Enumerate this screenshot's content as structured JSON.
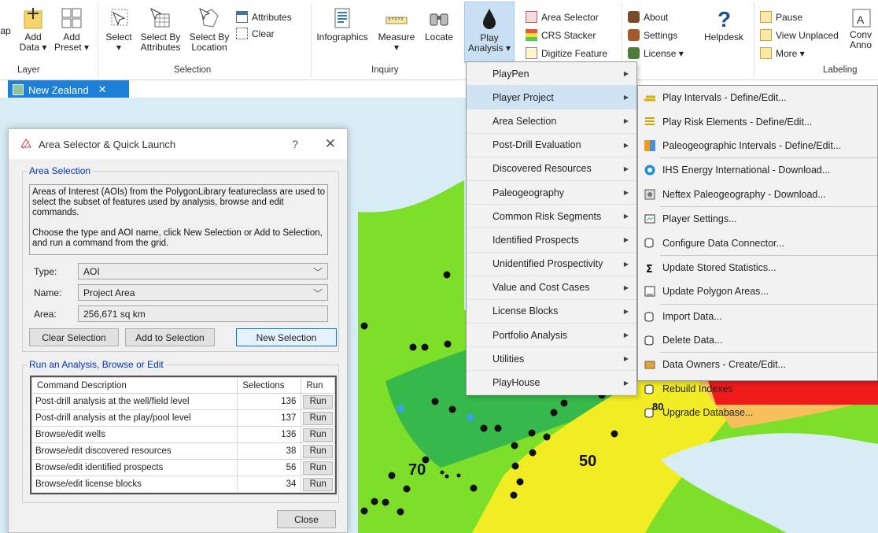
{
  "ribbon": {
    "map_partial": "ap",
    "add_data": "Add\nData ▾",
    "add_preset": "Add\nPreset ▾",
    "select": "Select\n▾",
    "select_by_attributes": "Select By\nAttributes",
    "select_by_location": "Select By\nLocation",
    "attributes": "Attributes",
    "clear": "Clear",
    "infographics": "Infographics",
    "measure": "Measure\n▾",
    "locate": "Locate",
    "play_analysis": "Play\nAnalysis ▾",
    "area_selector": "Area Selector",
    "crs_stacker": "CRS Stacker",
    "digitize_feature": "Digitize Feature",
    "about": "About",
    "settings": "Settings",
    "license": "License ▾",
    "helpdesk": "Helpdesk",
    "pause": "Pause",
    "view_unplaced": "View Unplaced",
    "more": "More ▾",
    "convert_annotation": "Conv\nAnno",
    "groups": {
      "layer": "Layer",
      "selection": "Selection",
      "inquiry": "Inquiry",
      "labeling": "Labeling"
    }
  },
  "doc_tab": {
    "label": "New Zealand",
    "close": "✕"
  },
  "map": {
    "labels": [
      "80",
      "50",
      "70"
    ]
  },
  "dialog": {
    "title": "Area Selector & Quick Launch",
    "help": "?",
    "close": "✕",
    "area_selection": {
      "legend": "Area Selection",
      "description": "Areas of Interest (AOIs) from the PolygonLibrary featureclass are used to select the subset of features used by analysis, browse and edit commands.\n\nChoose the type and AOI name, click New Selection or Add to Selection, and run a command from the grid.",
      "type_label": "Type:",
      "type_value": "AOI",
      "name_label": "Name:",
      "name_value": "Project Area",
      "area_label": "Area:",
      "area_value": "256,671 sq km",
      "clear_selection": "Clear Selection",
      "add_to_selection": "Add to Selection",
      "new_selection": "New Selection"
    },
    "run_group": {
      "legend": "Run an Analysis, Browse or Edit",
      "columns": [
        "Command Description",
        "Selections",
        "Run"
      ],
      "rows": [
        {
          "description": "Post-drill analysis at the well/field level",
          "selections": "136",
          "run": "Run"
        },
        {
          "description": "Post-drill analysis at the play/pool level",
          "selections": "137",
          "run": "Run"
        },
        {
          "description": "Browse/edit wells",
          "selections": "136",
          "run": "Run"
        },
        {
          "description": "Browse/edit discovered resources",
          "selections": "38",
          "run": "Run"
        },
        {
          "description": "Browse/edit identified prospects",
          "selections": "56",
          "run": "Run"
        },
        {
          "description": "Browse/edit license blocks",
          "selections": "34",
          "run": "Run"
        }
      ]
    },
    "close_button": "Close"
  },
  "main_menu": {
    "items": [
      "PlayPen",
      "Player Project",
      "Area Selection",
      "Post-Drill Evaluation",
      "Discovered Resources",
      "Paleogeography",
      "Common Risk Segments",
      "Identified Prospects",
      "Unidentified Prospectivity",
      "Value and Cost Cases",
      "License Blocks",
      "Portfolio Analysis",
      "Utilities",
      "PlayHouse"
    ],
    "highlighted": "Player Project"
  },
  "sub_menu": {
    "items": [
      "Play Intervals - Define/Edit...",
      "Play Risk Elements - Define/Edit...",
      "Paleogeographic Intervals - Define/Edit...",
      "IHS Energy International - Download...",
      "Neftex Paleogeography - Download...",
      "Player Settings...",
      "Configure Data Connector...",
      "Update Stored Statistics...",
      "Update Polygon Areas...",
      "Import Data...",
      "Delete Data...",
      "Data Owners - Create/Edit...",
      "Rebuild Indexes",
      "Upgrade Database..."
    ]
  },
  "colors": {
    "accent": "#1d80d6",
    "ocean": "#d8ecf6",
    "zone_dark_green": "#36b84a",
    "zone_light_green": "#7ddf29",
    "zone_yellow": "#f2ec24",
    "zone_orange": "#f6c15c",
    "zone_red": "#ef1b1b"
  }
}
